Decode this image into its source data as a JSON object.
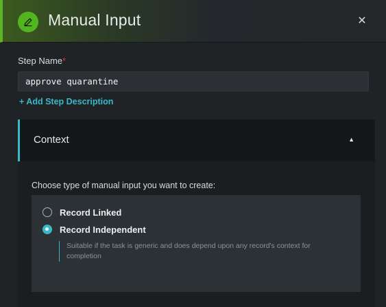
{
  "header": {
    "title": "Manual Input",
    "icon": "pencil-icon",
    "close_symbol": "✕",
    "accent_color": "#52b51f"
  },
  "form": {
    "step_name_label": "Step Name",
    "required_marker": "*",
    "step_name_value": "approve quarantine",
    "add_description_link": "+ Add Step Description"
  },
  "context": {
    "title": "Context",
    "chevron_symbol": "▲",
    "choose_label": "Choose type of manual input you want to create:",
    "options": [
      {
        "label": "Record Linked",
        "selected": false
      },
      {
        "label": "Record Independent",
        "selected": true
      }
    ],
    "hint": "Suitable if the task is generic and does depend upon any record's context for completion",
    "accent_color": "#3bb8c8"
  }
}
